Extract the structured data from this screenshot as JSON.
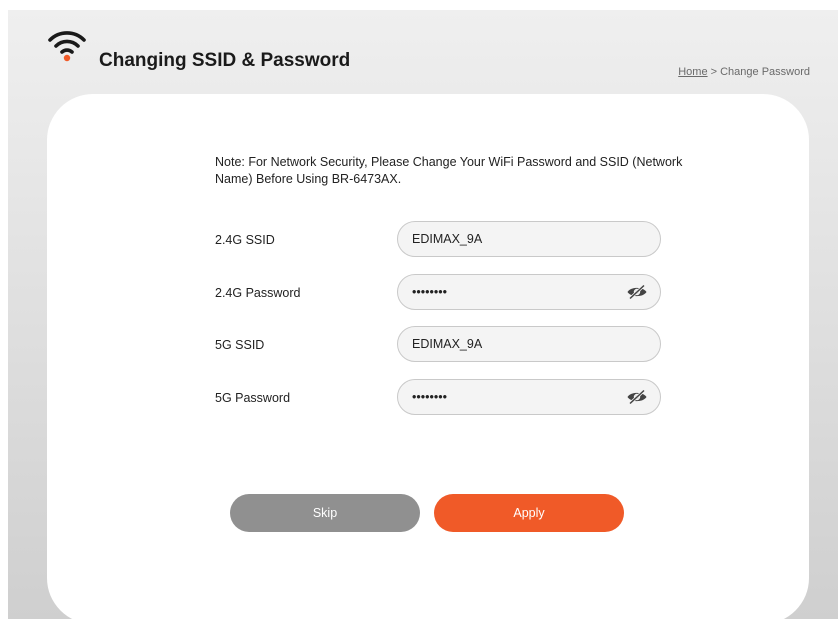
{
  "header": {
    "title": "Changing SSID & Password",
    "breadcrumb_home": "Home",
    "breadcrumb_separator": " > ",
    "breadcrumb_current": "Change Password"
  },
  "note": "Note: For Network Security, Please Change Your WiFi Password and SSID (Network Name) Before Using BR-6473AX.",
  "form": {
    "ssid_24": {
      "label": "2.4G SSID",
      "value": "EDIMAX_9A"
    },
    "password_24": {
      "label": "2.4G Password",
      "value": "••••••••"
    },
    "ssid_5": {
      "label": "5G SSID",
      "value": "EDIMAX_9A"
    },
    "password_5": {
      "label": "5G Password",
      "value": "••••••••"
    }
  },
  "buttons": {
    "skip_label": "Skip",
    "apply_label": "Apply"
  },
  "colors": {
    "accent": "#f05a28",
    "skip": "#909090",
    "field_background": "#f4f4f4"
  },
  "icons": {
    "header": "wifi-icon",
    "password_toggle": "eye-slash-icon"
  }
}
